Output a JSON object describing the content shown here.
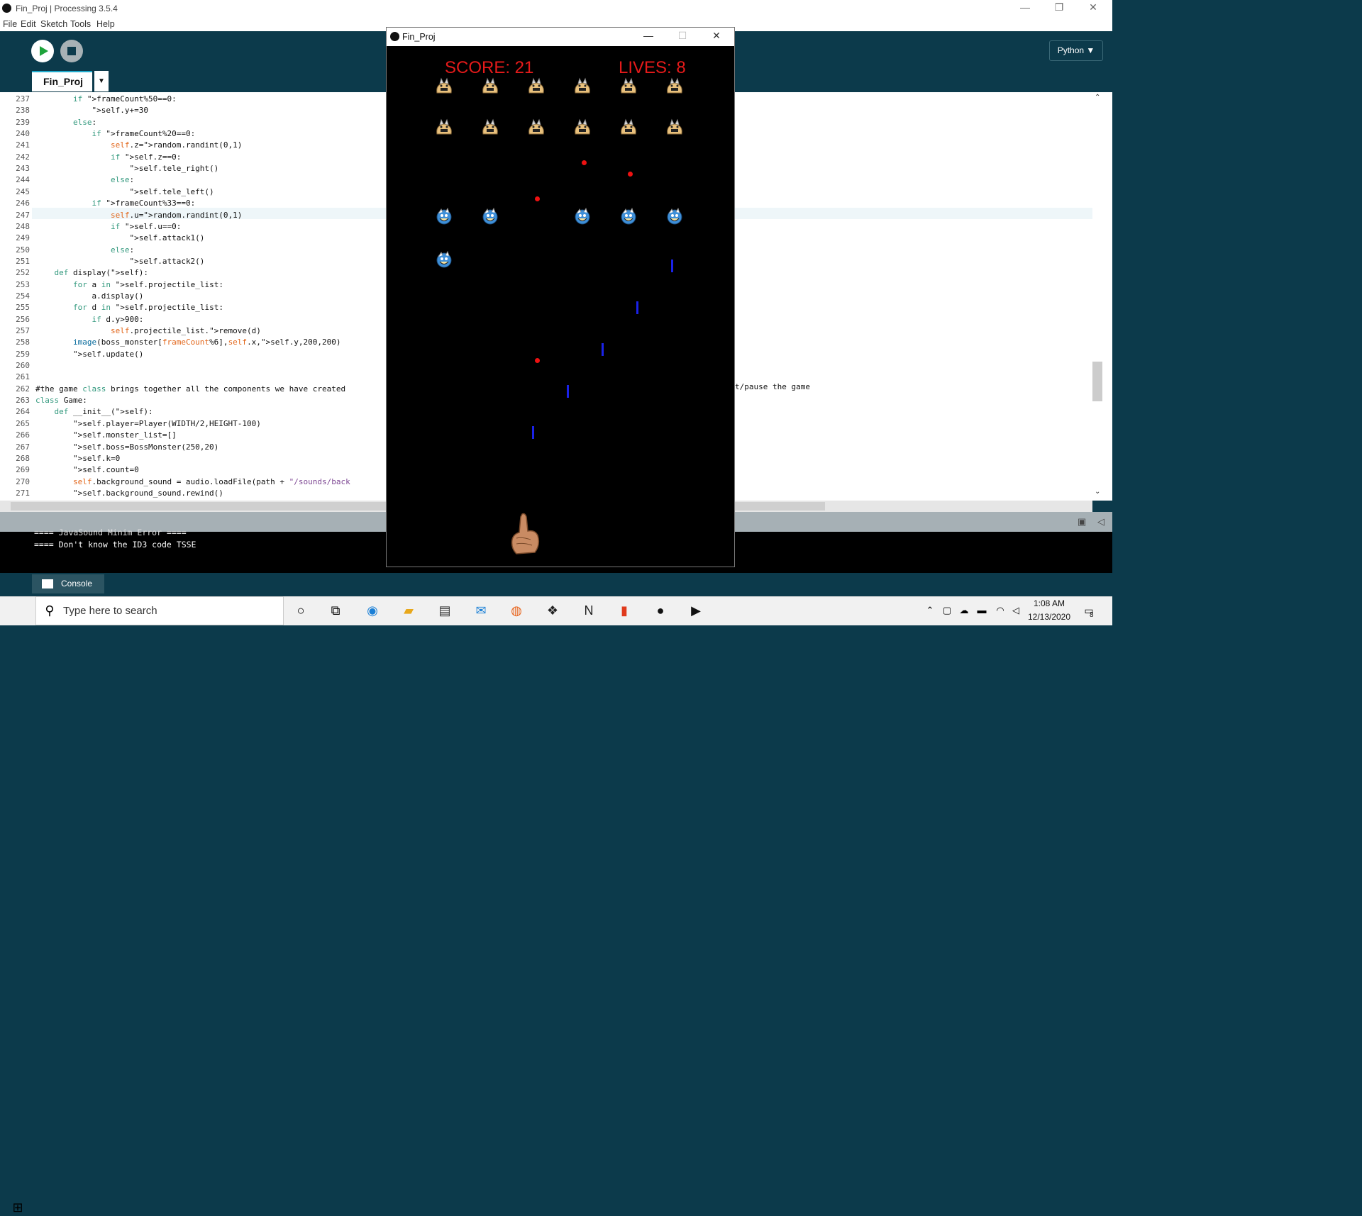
{
  "window": {
    "title": "Fin_Proj | Processing 3.5.4"
  },
  "menu": [
    "File",
    "Edit",
    "Sketch",
    "Tools",
    "Help"
  ],
  "toolbar": {
    "mode": "Python ▼"
  },
  "tab": {
    "label": "Fin_Proj",
    "menu": "▼"
  },
  "code": [
    {
      "n": "237",
      "t": "        if frameCount%50==0:"
    },
    {
      "n": "238",
      "t": "            self.y+=30"
    },
    {
      "n": "239",
      "t": "        else:"
    },
    {
      "n": "240",
      "t": "            if frameCount%20==0:"
    },
    {
      "n": "241",
      "t": "                self.z=random.randint(0,1)"
    },
    {
      "n": "242",
      "t": "                if self.z==0:"
    },
    {
      "n": "243",
      "t": "                    self.tele_right()"
    },
    {
      "n": "244",
      "t": "                else:"
    },
    {
      "n": "245",
      "t": "                    self.tele_left()"
    },
    {
      "n": "246",
      "t": "            if frameCount%33==0:"
    },
    {
      "n": "247",
      "t": "                self.u=random.randint(0,1)"
    },
    {
      "n": "248",
      "t": "                if self.u==0:"
    },
    {
      "n": "249",
      "t": "                    self.attack1()"
    },
    {
      "n": "250",
      "t": "                else:"
    },
    {
      "n": "251",
      "t": "                    self.attack2()"
    },
    {
      "n": "252",
      "t": "    def display(self):"
    },
    {
      "n": "253",
      "t": "        for a in self.projectile_list:"
    },
    {
      "n": "254",
      "t": "            a.display()"
    },
    {
      "n": "255",
      "t": "        for d in self.projectile_list:"
    },
    {
      "n": "256",
      "t": "            if d.y>900:"
    },
    {
      "n": "257",
      "t": "                self.projectile_list.remove(d)"
    },
    {
      "n": "258",
      "t": "        image(boss_monster[frameCount%6],self.x,self.y,200,200)"
    },
    {
      "n": "259",
      "t": "        self.update()"
    },
    {
      "n": "260",
      "t": ""
    },
    {
      "n": "261",
      "t": ""
    },
    {
      "n": "262",
      "t": "#the game class brings together all the components we have created"
    },
    {
      "n": "263",
      "t": "class Game:"
    },
    {
      "n": "264",
      "t": "    def __init__(self):"
    },
    {
      "n": "265",
      "t": "        self.player=Player(WIDTH/2,HEIGHT-100)"
    },
    {
      "n": "266",
      "t": "        self.monster_list=[]"
    },
    {
      "n": "267",
      "t": "        self.boss=BossMonster(250,20)"
    },
    {
      "n": "268",
      "t": "        self.k=0"
    },
    {
      "n": "269",
      "t": "        self.count=0"
    },
    {
      "n": "270",
      "t": "        self.background_sound = audio.loadFile(path + \"/sounds/back"
    },
    {
      "n": "271",
      "t": "        self.background_sound.rewind()"
    }
  ],
  "code_overflow_tail": "t/pause the game",
  "console": [
    "==== JavaSound Minim Error ====",
    "==== Don't know the ID3 code TSSE"
  ],
  "console_tab": "Console",
  "game": {
    "title": "Fin_Proj",
    "score": "SCORE: 21",
    "lives": "LIVES: 8",
    "colors": {
      "hud": "#e51a1a",
      "bullet": "#ee1111",
      "laser": "#1a22e8",
      "bg": "#000000"
    }
  },
  "taskbar": {
    "search_placeholder": "Type here to search",
    "time": "1:08 AM",
    "date": "12/13/2020",
    "notifications": "8"
  },
  "icons": [
    "windows-start-icon",
    "search-icon",
    "cortana-icon",
    "task-view-icon",
    "edge-icon",
    "file-explorer-icon",
    "store-icon",
    "mail-icon",
    "firefox-icon",
    "dropbox-icon",
    "notion-icon",
    "office-icon",
    "processing-icon",
    "sketch-run-icon"
  ]
}
